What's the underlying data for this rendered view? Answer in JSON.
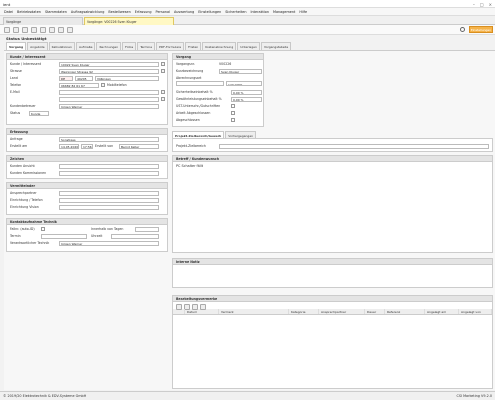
{
  "window": {
    "title": "ient"
  },
  "menu": [
    "Datei",
    "Betriebsdaten",
    "Stammdaten",
    "Auftragsabwicklung",
    "Bestellwesen",
    "Erfassung",
    "Personal",
    "Auswertung",
    "Einstellungen",
    "Sicherheiten",
    "Interaktion",
    "Management",
    "Hilfe"
  ],
  "tabs": [
    {
      "label": "Vorgänge"
    },
    {
      "label": "Vorgänge: V00226 Sven Kluger"
    }
  ],
  "toolbar": {
    "orange_btn": "Einstellungen"
  },
  "page": {
    "title": "Status Unbestätigt"
  },
  "subtabs": [
    "Vorgang",
    "Angebote",
    "Kalkulationen",
    "Aufmaße",
    "Rechnungen",
    "Fotos",
    "Termine",
    "PDF-Formulare",
    "Fristen",
    "Kostenabrechnung",
    "Unterlagen",
    "Vorgangstabelle"
  ],
  "kunde": {
    "header": "Kunde / Interessent",
    "kunde_label": "Kunde / Interessent",
    "kunde_value": "10022 Sven Kluger",
    "strasse_label": "Strasse",
    "strasse_value": "Weininger Strasse 92",
    "land_label": "Land",
    "land_value": "DE",
    "plz_value": "49205",
    "ort_value": "Vößingen",
    "telefon_label": "Telefon",
    "telefon_value": "06682 82 61 67",
    "telefon_type": "Mobiltelefon",
    "email_label": "E-Mail",
    "kundenbetreuer_label": "Kundenbetreuer",
    "kundenbetreuer_value": "Jürgen Werner",
    "status_label": "Status",
    "status_value": "Kunde"
  },
  "erfassung": {
    "header": "Erfassung",
    "anfrage_label": "Anfrage",
    "anfrage_value": "Sonstiges",
    "erstellt_label": "Erstellt am",
    "erstellt_date": "14.05.2020",
    "erstellt_time": "17:56",
    "erstellt_von_label": "Erstellt von",
    "erstellt_von_value": "Bernd Keller"
  },
  "zeichen": {
    "header": "Zeichen",
    "ansicht_label": "Kunden Ansicht",
    "kommissionen_label": "Kunden Kommissionen"
  },
  "vermittlung": {
    "header": "Vermittelnder",
    "ansprech_label": "Ansprechpartner",
    "email_label": "Einrichtung / Telefon",
    "einrichtungs_label": "Einrichtung Vision"
  },
  "kontakt": {
    "header": "Kontaktaufnahme Technik",
    "fallnr_label": "Fallnr. (auto-ID)",
    "intern_label": "Innerhalb von Tagen",
    "intern_value": "",
    "termin_label": "Termin",
    "uhrzeit_label": "Uhrzeit",
    "verantwortlich_label": "Verantwortlicher Technik",
    "verantwortlich_value": "Jürgen Werner"
  },
  "vorgang": {
    "header": "Vorgang",
    "vorgangsnr_label": "Vorgangsnr.",
    "vorgangsnr_value": "V00226",
    "kurz_label": "Kurzbezeichnung",
    "kurz_value": "Sven Kluger",
    "abrechnungsart_label": "Abrechnungsart",
    "abrechnungsart_value": "",
    "betrag_value": "120.0000",
    "sicherheit_label": "Sicherheitseinbehalt %",
    "sicherheit_value": "0,00 %",
    "gewaehr_label": "Gewährleistungseinbehalt %",
    "gewaehr_value": "0,00 %",
    "ust_label": "UST-Unterschr./Gutschriften",
    "arbeit_label": "Arbeit Abgeschlossen",
    "abgeschlossen_label": "Abgeschlossen"
  },
  "projektdaten": {
    "tabs": [
      "Projekt-Zielbereich/Gewerk",
      "Vorhergegangen"
    ],
    "projekt_label": "Projekt-Zielbereich"
  },
  "betreff": {
    "header": "Betreff / Kundenwunsch",
    "text": "PC Schalter fällt"
  },
  "interne": {
    "header": "Interne Notiz"
  },
  "bearbeitung": {
    "header": "Bearbeitungsvermerke",
    "columns": [
      "Datum",
      "Vermerk",
      "Kategorie",
      "Ansprechpartner",
      "Dauer",
      "Referenz",
      "Angelegt am",
      "Angelegt von"
    ]
  },
  "status": {
    "left": "© 2019/20 Elektrotechnik & EDV-Systeme GmbH",
    "right": "CSI Marketing V9.2.0"
  }
}
